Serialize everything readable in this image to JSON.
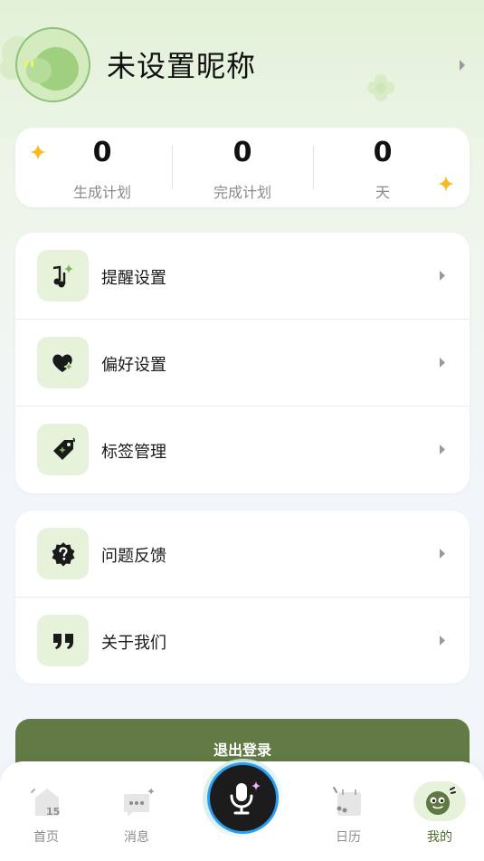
{
  "profile": {
    "nickname": "未设置昵称"
  },
  "stats": [
    {
      "value": "0",
      "label": "生成计划"
    },
    {
      "value": "0",
      "label": "完成计划"
    },
    {
      "value": "0",
      "label": "天"
    }
  ],
  "menu_group_1": [
    {
      "label": "提醒设置",
      "icon": "music-note-sparkle-icon"
    },
    {
      "label": "偏好设置",
      "icon": "heart-sparkle-icon"
    },
    {
      "label": "标签管理",
      "icon": "tag-icon"
    }
  ],
  "menu_group_2": [
    {
      "label": "问题反馈",
      "icon": "question-badge-icon"
    },
    {
      "label": "关于我们",
      "icon": "quote-icon"
    }
  ],
  "logout_label": "退出登录",
  "tabbar": {
    "tabs": [
      {
        "label": "首页",
        "icon": "home-calendar-icon",
        "badge": "15"
      },
      {
        "label": "消息",
        "icon": "chat-bubble-icon"
      },
      {
        "label": "日历",
        "icon": "calendar-icon"
      },
      {
        "label": "我的",
        "icon": "profile-face-icon",
        "active": true
      }
    ],
    "center_icon": "microphone-icon"
  },
  "colors": {
    "accent_green": "#627a43",
    "icon_bg": "#e6f3da",
    "mic_ring": "#2a9df4",
    "star_yellow": "#f7b91c"
  }
}
